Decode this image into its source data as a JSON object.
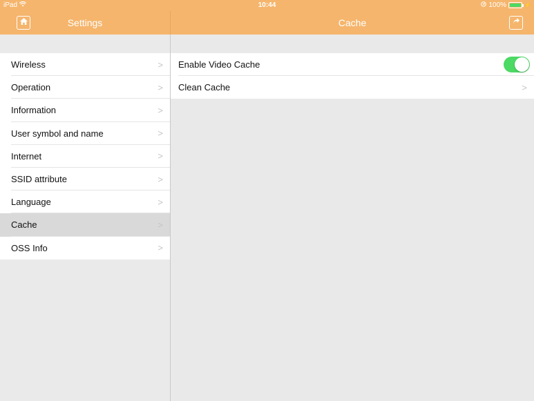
{
  "status_bar": {
    "device": "iPad",
    "time": "10:44",
    "battery_percent": "100%",
    "battery_level": 1.0
  },
  "nav": {
    "left_title": "Settings",
    "right_title": "Cache"
  },
  "menu": {
    "items": [
      {
        "label": "Wireless"
      },
      {
        "label": "Operation"
      },
      {
        "label": "Information"
      },
      {
        "label": "User symbol and name"
      },
      {
        "label": "Internet"
      },
      {
        "label": "SSID attribute"
      },
      {
        "label": "Language"
      },
      {
        "label": "Cache"
      },
      {
        "label": "OSS Info"
      }
    ],
    "selected": "Cache"
  },
  "detail": {
    "rows": [
      {
        "label": "Enable Video Cache",
        "toggle_on": true
      },
      {
        "label": "Clean Cache"
      }
    ]
  },
  "colors": {
    "accent": "#f5b56c",
    "toggle_on": "#4cd964",
    "selected_row": "#d9d9d9"
  },
  "icons": {
    "home": "home-icon",
    "share": "share-icon",
    "wifi": "wifi-icon",
    "location": "location-icon",
    "battery": "battery-icon",
    "chevron": "chevron-right-icon"
  }
}
